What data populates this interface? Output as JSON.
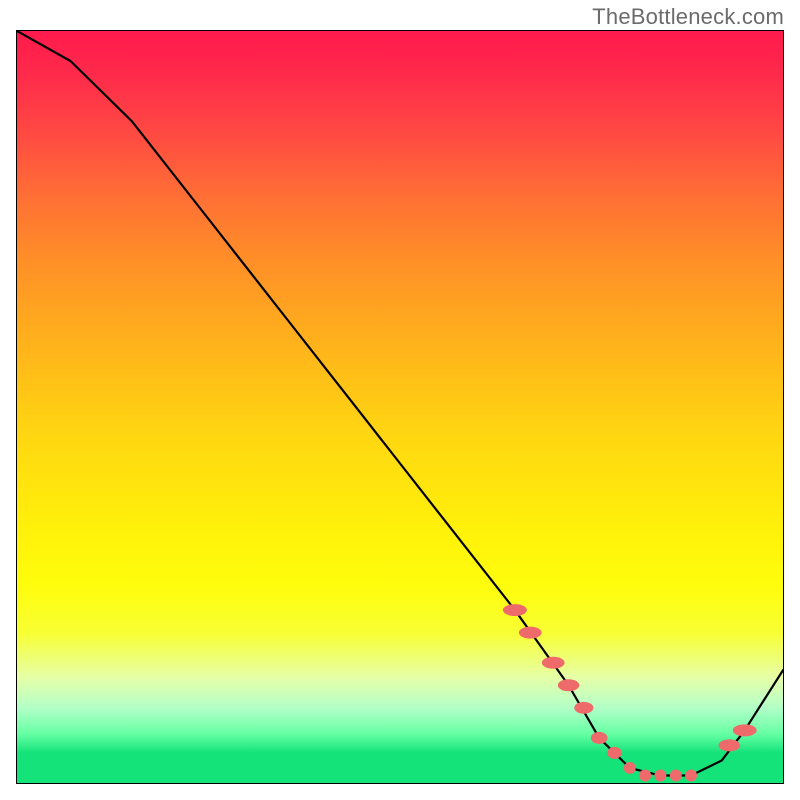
{
  "attribution": "TheBottleneck.com",
  "chart_data": {
    "type": "line",
    "title": "",
    "xlabel": "",
    "ylabel": "",
    "xlim": [
      0,
      100
    ],
    "ylim": [
      0,
      100
    ],
    "background_gradient": {
      "direction": "vertical",
      "stops": [
        {
          "pos": 0,
          "color": "#ff1a4d"
        },
        {
          "pos": 50,
          "color": "#ffd400"
        },
        {
          "pos": 80,
          "color": "#f8ff33"
        },
        {
          "pos": 96,
          "color": "#14e37a"
        },
        {
          "pos": 100,
          "color": "#14e37a"
        }
      ]
    },
    "series": [
      {
        "name": "bottleneck-curve",
        "color": "#000000",
        "x": [
          0,
          7,
          15,
          25,
          35,
          45,
          55,
          65,
          72,
          76,
          80,
          84,
          88,
          92,
          95,
          100
        ],
        "y": [
          100,
          96,
          88,
          75,
          62,
          49,
          36,
          23,
          13,
          6,
          2,
          1,
          1,
          3,
          7,
          15
        ]
      }
    ],
    "markers": {
      "name": "highlight-region",
      "color": "#ef6a6a",
      "radius": 6,
      "x": [
        65,
        67,
        70,
        72,
        74,
        76,
        78,
        80,
        82,
        84,
        86,
        88,
        93,
        95
      ],
      "y": [
        23,
        20,
        16,
        13,
        10,
        6,
        4,
        2,
        1,
        1,
        1,
        1,
        5,
        7
      ],
      "stretch_y": [
        2.0,
        1.9,
        1.9,
        1.8,
        1.6,
        1.4,
        1.2,
        1.0,
        1.0,
        1.0,
        1.0,
        1.0,
        1.8,
        2.0
      ]
    }
  }
}
